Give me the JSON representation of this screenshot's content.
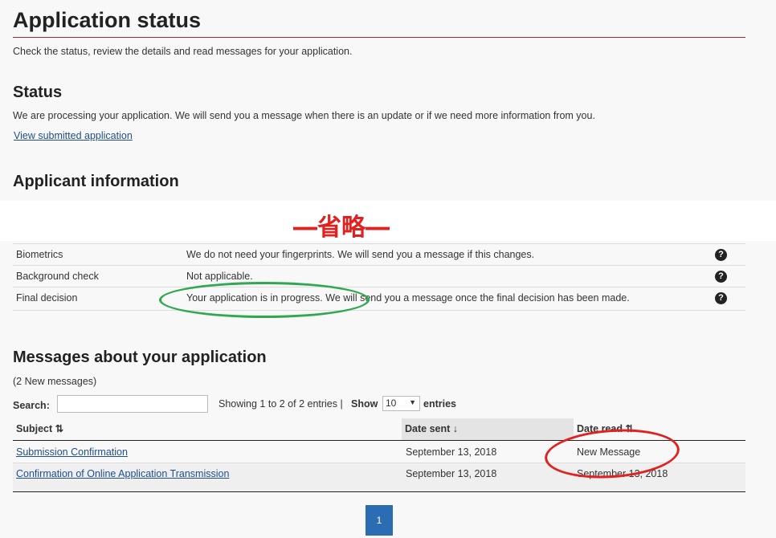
{
  "header": {
    "title": "Application status",
    "subtitle": "Check the status, review the details and read messages for your application."
  },
  "status": {
    "heading": "Status",
    "text": "We are processing your application. We will send you a message when there is an update or if we need more information from you.",
    "link": "View submitted application"
  },
  "applicant": {
    "heading": "Applicant information",
    "omitted_label": "―省略―",
    "rows": [
      {
        "label": "Biometrics",
        "value": "We do not need your fingerprints. We will send you a message if this changes."
      },
      {
        "label": "Background check",
        "value": "Not applicable."
      },
      {
        "label": "Final decision",
        "value": "Your application is in progress. We will send you a message once the final decision has been made."
      }
    ]
  },
  "messages": {
    "heading": "Messages about your application",
    "count": "(2 New messages)",
    "search_label": "Search:",
    "search_value": "",
    "showing": "Showing 1 to 2 of 2 entries |",
    "show_label": "Show",
    "page_size": "10",
    "entries_label": "entries",
    "columns": [
      "Subject ⇅",
      "Date sent ↓",
      "Date read ⇅"
    ],
    "rows": [
      {
        "subject": "Submission Confirmation",
        "sent": "September 13, 2018",
        "read": "New Message"
      },
      {
        "subject": "Confirmation of Online Application Transmission",
        "sent": "September 13, 2018",
        "read": "September 13, 2018"
      }
    ],
    "current_page": "1"
  },
  "colors": {
    "accent_line": "#b4233a",
    "pagination": "#2a6db3",
    "annotation_red": "#e0211f",
    "annotation_green": "#2fa84f"
  }
}
